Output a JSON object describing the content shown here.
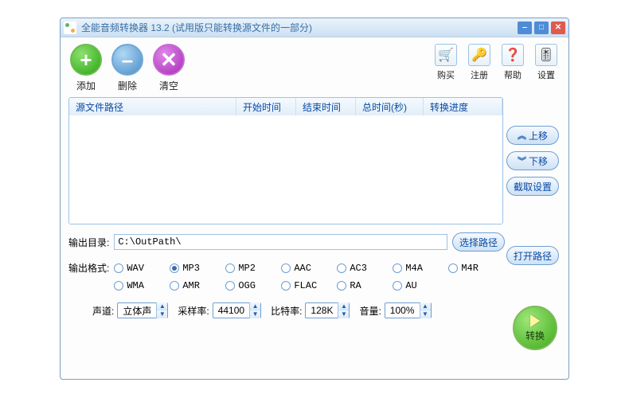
{
  "window": {
    "title": "全能音频转换器 13.2 (试用版只能转换源文件的一部分)"
  },
  "toolbar": {
    "add": "添加",
    "delete": "删除",
    "clear": "清空",
    "buy": "购买",
    "register": "注册",
    "help": "帮助",
    "settings": "设置"
  },
  "columns": {
    "path": "源文件路径",
    "start": "开始时间",
    "end": "结束时间",
    "total": "总时间(秒)",
    "progress": "转换进度"
  },
  "side": {
    "moveup": "上移",
    "movedown": "下移",
    "capture": "截取设置"
  },
  "output": {
    "dir_label": "输出目录:",
    "dir_value": "C:\\OutPath\\",
    "choose_path": "选择路径",
    "open_path": "打开路径",
    "format_label": "输出格式:",
    "formats": [
      "WAV",
      "MP3",
      "MP2",
      "AAC",
      "AC3",
      "M4A",
      "M4R",
      "WMA",
      "AMR",
      "OGG",
      "FLAC",
      "RA",
      "AU"
    ],
    "selected_format": "MP3"
  },
  "audio": {
    "channel_label": "声道:",
    "channel_value": "立体声",
    "samplerate_label": "采样率:",
    "samplerate_value": "44100",
    "bitrate_label": "比特率:",
    "bitrate_value": "128K",
    "volume_label": "音量:",
    "volume_value": "100%"
  },
  "convert": {
    "label": "转换"
  }
}
